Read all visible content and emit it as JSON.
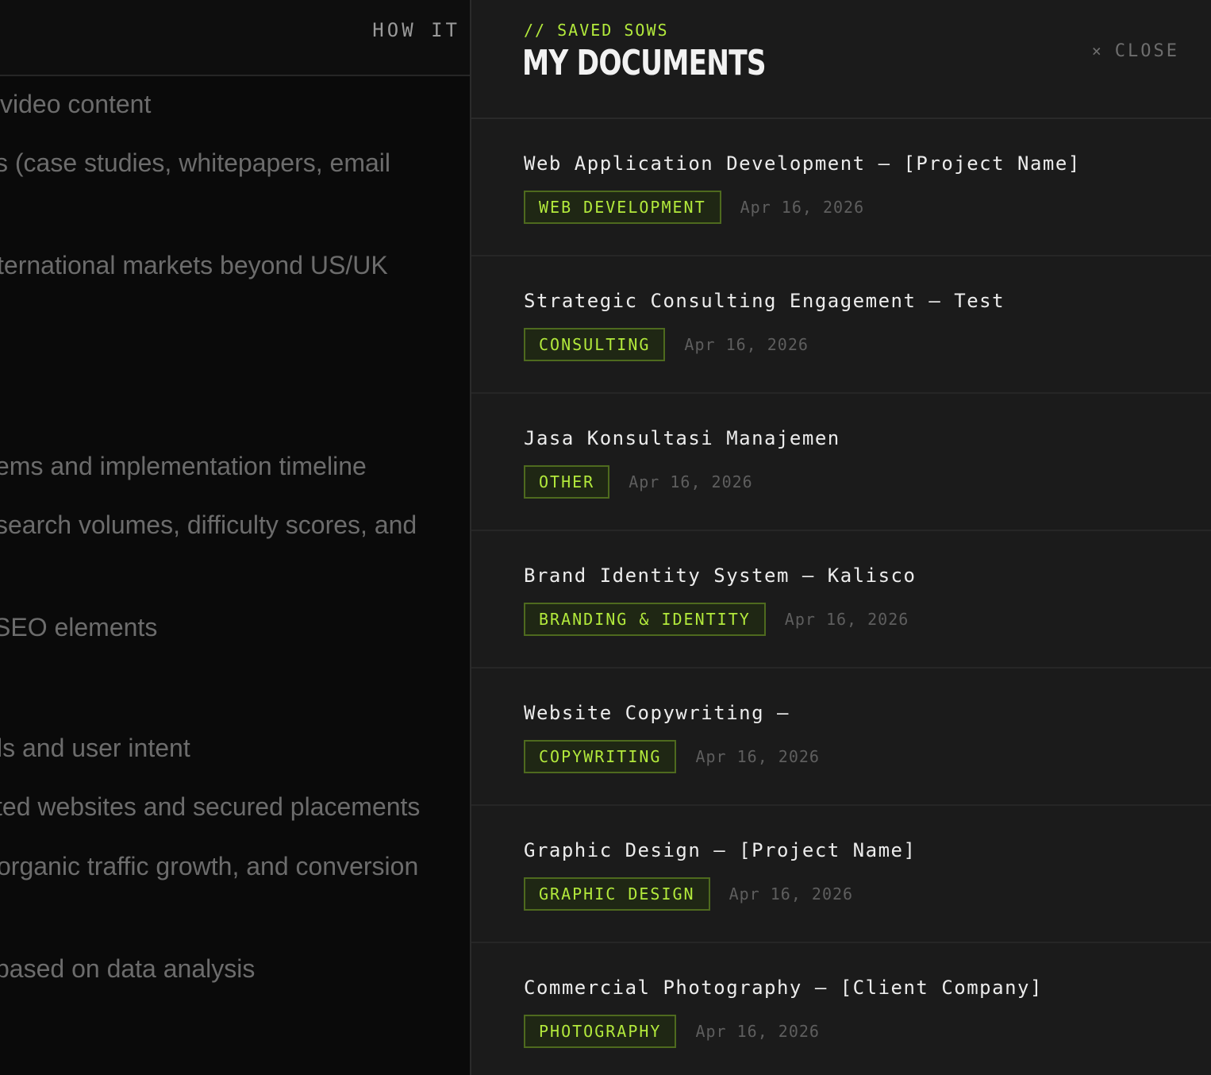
{
  "background": {
    "nav_label": "HOW IT",
    "lines": [
      " video content",
      "s (case studies, whitepapers, email",
      "ternational markets beyond US/UK",
      "ems and implementation timeline",
      " search volumes, difficulty scores, and",
      "SEO elements",
      "ls and user intent",
      "ted websites and secured placements",
      "organic traffic growth, and conversion",
      " based on data analysis"
    ]
  },
  "drawer": {
    "eyebrow": "// SAVED SOWS",
    "title": "MY DOCUMENTS",
    "close_icon": "×",
    "close_label": "CLOSE",
    "documents": [
      {
        "title": "Web Application Development — [Project Name]",
        "category": "WEB DEVELOPMENT",
        "date": "Apr 16, 2026"
      },
      {
        "title": "Strategic Consulting Engagement — Test",
        "category": "CONSULTING",
        "date": "Apr 16, 2026"
      },
      {
        "title": "Jasa Konsultasi Manajemen",
        "category": "OTHER",
        "date": "Apr 16, 2026"
      },
      {
        "title": "Brand Identity System — Kalisco",
        "category": "BRANDING & IDENTITY",
        "date": "Apr 16, 2026"
      },
      {
        "title": "Website Copywriting —",
        "category": "COPYWRITING",
        "date": "Apr 16, 2026"
      },
      {
        "title": "Graphic Design — [Project Name]",
        "category": "GRAPHIC DESIGN",
        "date": "Apr 16, 2026"
      },
      {
        "title": "Commercial Photography — [Client Company]",
        "category": "PHOTOGRAPHY",
        "date": "Apr 16, 2026"
      }
    ]
  },
  "colors": {
    "accent": "#b3ea3c",
    "drawer_bg": "#1b1b1b",
    "page_bg": "#0a0a0a"
  }
}
